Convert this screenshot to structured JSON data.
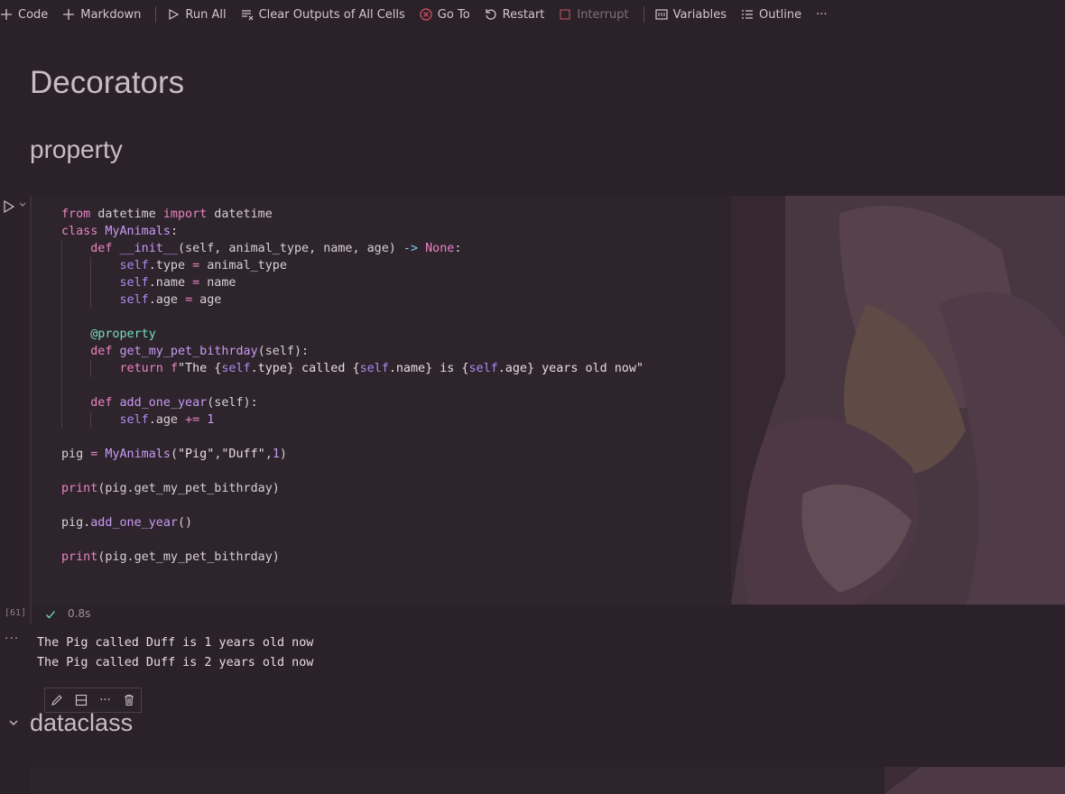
{
  "toolbar": {
    "code": "Code",
    "markdown": "Markdown",
    "run_all": "Run All",
    "clear_outputs": "Clear Outputs of All Cells",
    "go_to": "Go To",
    "restart": "Restart",
    "interrupt": "Interrupt",
    "variables": "Variables",
    "outline": "Outline",
    "more": "···"
  },
  "headings": {
    "title": "Decorators",
    "property": "property",
    "dataclass": "dataclass"
  },
  "cell1": {
    "exec_count": "[61]",
    "exec_time": "0.8s",
    "output_more": "···",
    "output_lines": [
      "The Pig called Duff is 1 years old now",
      "The Pig called Duff is 2 years old now"
    ]
  },
  "cell_toolbar": {
    "more": "···"
  },
  "colors": {
    "background": "#2b2128",
    "keyword": "#e884c1",
    "class_name": "#c89af5",
    "decorator": "#72e0b8",
    "error_red": "#e0556b"
  }
}
